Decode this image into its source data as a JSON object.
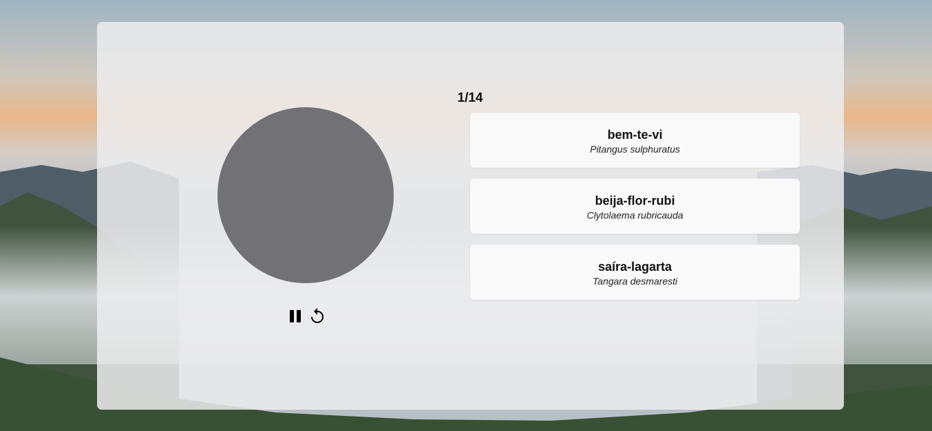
{
  "quiz": {
    "progress": "1/14"
  },
  "player": {
    "pause_icon": "pause-icon",
    "replay_icon": "replay-icon"
  },
  "options": [
    {
      "common_name": "bem-te-vi",
      "scientific_name": "Pitangus sulphuratus"
    },
    {
      "common_name": "beija-flor-rubi",
      "scientific_name": "Clytolaema rubricauda"
    },
    {
      "common_name": "saíra-lagarta",
      "scientific_name": "Tangara desmaresti"
    }
  ],
  "colors": {
    "card_background": "#ececee",
    "disc": "#727176",
    "option_background": "#f9f9f9",
    "text": "#111111"
  }
}
